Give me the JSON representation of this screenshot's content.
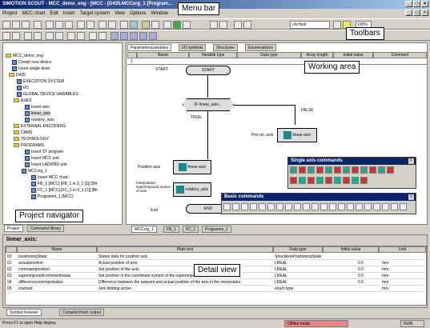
{
  "window": {
    "title": "SIMOTION SCOUT - MCC_demo_eng - [MCC - [D435.MCCsrg_1 [Program..."
  },
  "menu": {
    "items": [
      "Project",
      "MCC chart",
      "Edit",
      "Insert",
      "Target system",
      "View",
      "Options",
      "Window"
    ]
  },
  "toolbar": {
    "combo_value": "cfa fbstr",
    "combo2_value": "100%"
  },
  "callouts": {
    "menu_bar": "Menu bar",
    "toolbars": "Toolbars",
    "working_area": "Working area",
    "project_navigator": "Project navigator",
    "detail_view": "Detail view"
  },
  "navigator": {
    "items": [
      "MCC_demo_eng",
      "Create new device",
      "Insert single drive",
      "D435",
      "EXECUTION SYSTEM",
      "I/O",
      "GLOBAL DEVICE VARIABLES",
      "AXES",
      "Insert axis",
      "linear_axis",
      "rotatory_axis",
      "EXTERNAL ENCODERS",
      "CAMS",
      "TECHNOLOGY",
      "PROGRAMS",
      "Insert ST program",
      "Insert MCC unit",
      "Insert LAD/FBD unit",
      "MCCsrg_1",
      "Insert MCC chart",
      "FB_1 [MCC] [FB_1 in 0_1 [1]] [Bit",
      "FC_1 [MCC] [FC_1 in 0_1 [1]] [Bit",
      "Programm_1 [MCC]"
    ],
    "tabs": [
      "Project",
      "Command library"
    ]
  },
  "editor": {
    "tabs": [
      "Parameters/variables",
      "I/O symbols",
      "Structures",
      "Enumerations"
    ],
    "columns": [
      "Name",
      "Variable type",
      "Data type",
      "Array length",
      "Initial value",
      "Comment"
    ],
    "row_num": "1",
    "flow": {
      "start": "START",
      "if_label": "IF linear_axis...",
      "true_label": "TRUE",
      "false_label": "FALSE",
      "pos_axis_label": "Position axis",
      "pos_axis_block": "linear axis",
      "rel_axis_label": "Pos rel. axis",
      "rel_axis_block": "linear axis",
      "rotatory_label": "Interpolation superimposed motion of axis",
      "rotatory_block": "rotatory_axis",
      "end_label": "End",
      "end_block": "END"
    },
    "bottom_tabs": [
      "MCCsrg_1",
      "FB_1",
      "FC_1",
      "Programm_1"
    ]
  },
  "single_axis": {
    "title": "Single axis commands"
  },
  "basic": {
    "title": "Basic commands"
  },
  "detail": {
    "title": "linear_axis:",
    "columns": [
      "",
      "Name",
      "Plain text",
      "Data type",
      "Initial value",
      "Unit"
    ],
    "rows": [
      [
        "63",
        "positioningState",
        "Status data for position axis",
        "StructAxisPositioningState",
        "",
        ""
      ],
      [
        "61",
        "actualposition",
        "Actual position of axis",
        "LREAL",
        "0.0",
        "mm"
      ],
      [
        "62",
        "commandposition",
        "Set position of the axis",
        "LREAL",
        "0.0",
        "mm"
      ],
      [
        "63",
        "superimposedcommandvalue",
        "Set position in the coordinate system of the superimposed motion of the axis",
        "LREAL",
        "0.0",
        "mm"
      ],
      [
        "64",
        "differencecommandvalue",
        "Difference between the setpoint and actual position of the axis in the interpolator",
        "LREAL",
        "0.0",
        "mm"
      ],
      [
        "65",
        "vramwd",
        "Jerk limiting active",
        "enum type",
        "",
        "m/s"
      ]
    ],
    "tabs": [
      "Symbol browser",
      "Compile/check output"
    ]
  },
  "status": {
    "left": "Press F1 to open Help display.",
    "mode": "Offline mode",
    "num": "NUM"
  }
}
